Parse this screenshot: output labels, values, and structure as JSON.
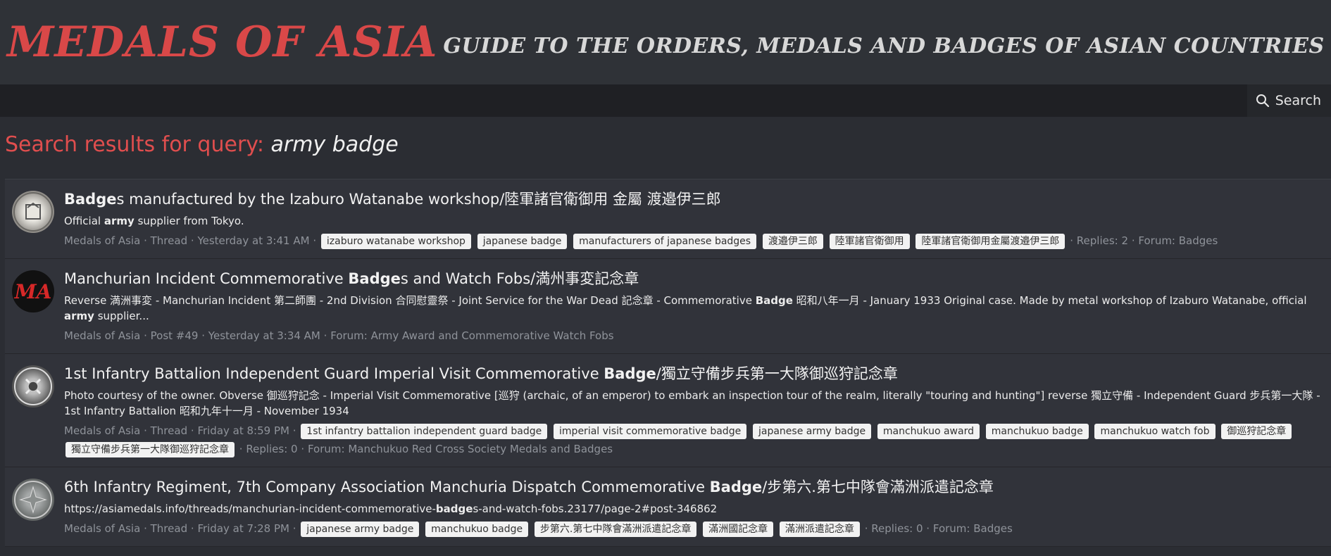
{
  "site": {
    "logo": "MEDALS OF ASIA",
    "tagline": "GUIDE TO THE ORDERS, MEDALS AND BADGES OF ASIAN COUNTRIES"
  },
  "nav": {
    "search_label": "Search"
  },
  "page": {
    "title_prefix": "Search results for query:",
    "query": "army badge"
  },
  "results": [
    {
      "title_bold": "Badge",
      "title_rest": "s manufactured by the Izaburo Watanabe workshop/陸軍諸官衛御用 金屬 渡邉伊三郎",
      "snippet_a": "Official ",
      "snippet_b": "army",
      "snippet_c": " supplier from Tokyo.",
      "author": "Medals of Asia",
      "type": "Thread",
      "time": "Yesterday at 3:41 AM",
      "tags": [
        "izaburo watanabe workshop",
        "japanese badge",
        "manufacturers of japanese badges",
        "渡邉伊三郎",
        "陸軍諸官衛御用",
        "陸軍諸官衛御用金屬渡邉伊三郎"
      ],
      "replies": "Replies: 2",
      "forum": "Forum: Badges"
    },
    {
      "title_a": "Manchurian Incident Commemorative ",
      "title_bold": "Badge",
      "title_rest": "s and Watch Fobs/満州事変記念章",
      "snippet_a": "Reverse 満洲事変 - Manchurian Incident 第二師團 - 2nd Division 合同慰靈祭 - Joint Service for the War Dead 記念章 - Commemorative ",
      "snippet_b": "Badge",
      "snippet_c": " 昭和八年一月 - January 1933 Original case. Made by metal workshop of Izaburo Watanabe, official ",
      "snippet_d": "army",
      "snippet_e": " supplier...",
      "author": "Medals of Asia",
      "type": "Post #49",
      "time": "Yesterday at 3:34 AM",
      "forum": "Forum: Army Award and Commemorative Watch Fobs"
    },
    {
      "title_a": "1st Infantry Battalion Independent Guard Imperial Visit Commemorative ",
      "title_bold": "Badge",
      "title_rest": "/獨立守備步兵第一大隊御巡狩記念章",
      "snippet": "Photo courtesy of the owner. Obverse 御巡狩記念 - Imperial Visit Commemorative [巡狩 (archaic, of an emperor) to embark an inspection tour of the realm, literally \"touring and hunting\"] reverse 獨立守備 - Independent Guard 步兵第一大隊 - 1st Infantry Battalion 昭和九年十一月 - November 1934",
      "author": "Medals of Asia",
      "type": "Thread",
      "time": "Friday at 8:59 PM",
      "tags": [
        "1st infantry battalion independent guard badge",
        "imperial visit commemorative badge",
        "japanese army badge",
        "manchukuo award",
        "manchukuo badge",
        "manchukuo watch fob",
        "御巡狩記念章",
        "獨立守備步兵第一大隊御巡狩記念章"
      ],
      "replies": "Replies: 0",
      "forum": "Forum: Manchukuo Red Cross Society Medals and Badges"
    },
    {
      "title_a": "6th Infantry Regiment, 7th Company Association Manchuria Dispatch Commemorative ",
      "title_bold": "Badge",
      "title_rest": "/步第六.第七中隊會滿洲派遣記念章",
      "snippet_a": "https://asiamedals.info/threads/manchurian-incident-commemorative-",
      "snippet_b": "badge",
      "snippet_c": "s-and-watch-fobs.23177/page-2#post-346862",
      "author": "Medals of Asia",
      "type": "Thread",
      "time": "Friday at 7:28 PM",
      "tags": [
        "japanese army badge",
        "manchukuo badge",
        "步第六.第七中隊會滿洲派遣記念章",
        "滿洲國記念章",
        "滿洲派遣記念章"
      ],
      "replies": "Replies: 0",
      "forum": "Forum: Badges"
    }
  ],
  "colors": {
    "accent_red": "#d94848",
    "background": "#2b2d33",
    "tag_bg": "#f2f2f2",
    "meta_text": "#8f939a"
  }
}
